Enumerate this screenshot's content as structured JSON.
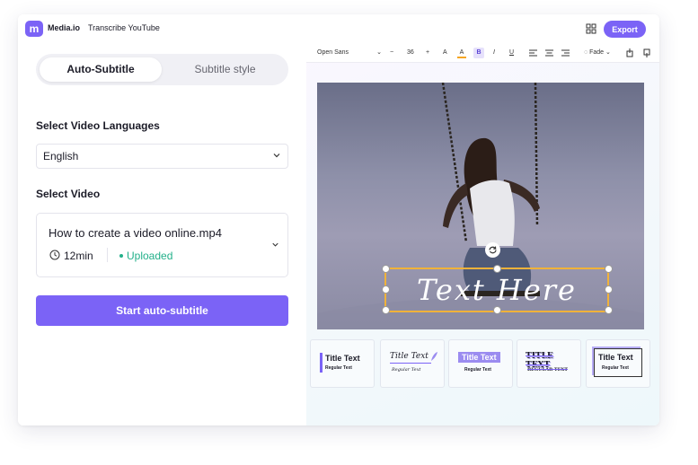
{
  "app": {
    "brand": "Media.io",
    "logo_glyph": "m",
    "tool_name": "Transcribe YouTube",
    "export_label": "Export",
    "accent": "#7b63f6"
  },
  "left": {
    "tabs": [
      {
        "label": "Auto-Subtitle",
        "active": true
      },
      {
        "label": "Subtitle style",
        "active": false
      }
    ],
    "language_heading": "Select Video Languages",
    "language_value": "English",
    "video_heading": "Select Video",
    "video": {
      "file_name": "How to create a video online.mp4",
      "duration": "12min",
      "status": "Uploaded",
      "status_color": "#23b08a"
    },
    "start_button": "Start auto-subtitle"
  },
  "toolbar": {
    "font": "Open Sans",
    "minus": "−",
    "size": "36",
    "plus": "+",
    "text_color_icon": "A",
    "highlight_icon": "A",
    "bold": "B",
    "italic": "I",
    "underline": "U",
    "effect": "Fade"
  },
  "canvas": {
    "overlay_text": "Text Here",
    "selection_color": "#f0b23a"
  },
  "styles": [
    {
      "title": "Title Text",
      "sub": "Regular Text"
    },
    {
      "title": "Title Text",
      "sub": "Regular Text"
    },
    {
      "title": "Title Text",
      "sub": "Regular Text"
    },
    {
      "title": "TITLE TEXT",
      "sub": "REGULAR TEXT"
    },
    {
      "title": "Title Text",
      "sub": "Regular Text"
    }
  ]
}
